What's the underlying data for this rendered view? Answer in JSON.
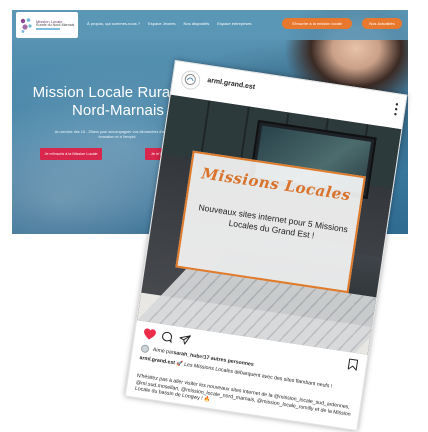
{
  "site": {
    "logo_line1": "Mission Locale",
    "logo_line2": "Rurale du Nord-Marnais",
    "nav": [
      "À propos, qui sommes-nous ?",
      "Espace Jeunes",
      "Nos dispositifs",
      "Espace entreprises"
    ],
    "cta_register": "S'inscrire à la mission locale",
    "cta_news": "Nos Actualités",
    "hero_title": "Mission Locale Rurale du Nord-Marnais",
    "hero_subtitle": "Au service des 16 - 25ans pour accompagner vos démarches d'accès à la formation et à l'emploi",
    "hero_btn_1": "Je m'inscris à la Mission Locale",
    "hero_btn_2": "Je m'inscris aux ateliers"
  },
  "post": {
    "username": "arml.grand.est",
    "image_title": "Missions Locales",
    "image_text": "Nouveaux sites internet pour 5 Missions Locales du Grand Est !",
    "likes_prefix": "Aimé par ",
    "likes_user": "sarah_hub",
    "likes_mid": " et ",
    "likes_count": "17 autres personnes",
    "caption_user": "arml.grand.est",
    "caption_text": " 🚀 Les Missions Locales débarquent avec des sites flambant neufs !",
    "caption2_text": "N'hésitez pas à aller visiter les nouveaux sites internet de la ",
    "caption2_tags": "@mission_locale_sud_ardennes, @ml.sud.mosellan, @mission_locale_nord_marnais, @mission_locale_romilly",
    "caption2_tail": " et de la Mission Locale du bassin de Longwy ! 🔥"
  },
  "colors": {
    "site_accent": "#e8782e",
    "site_hero_btn": "#d9264d",
    "overlay_title": "#d9732b",
    "like_heart": "#ed2c49"
  }
}
